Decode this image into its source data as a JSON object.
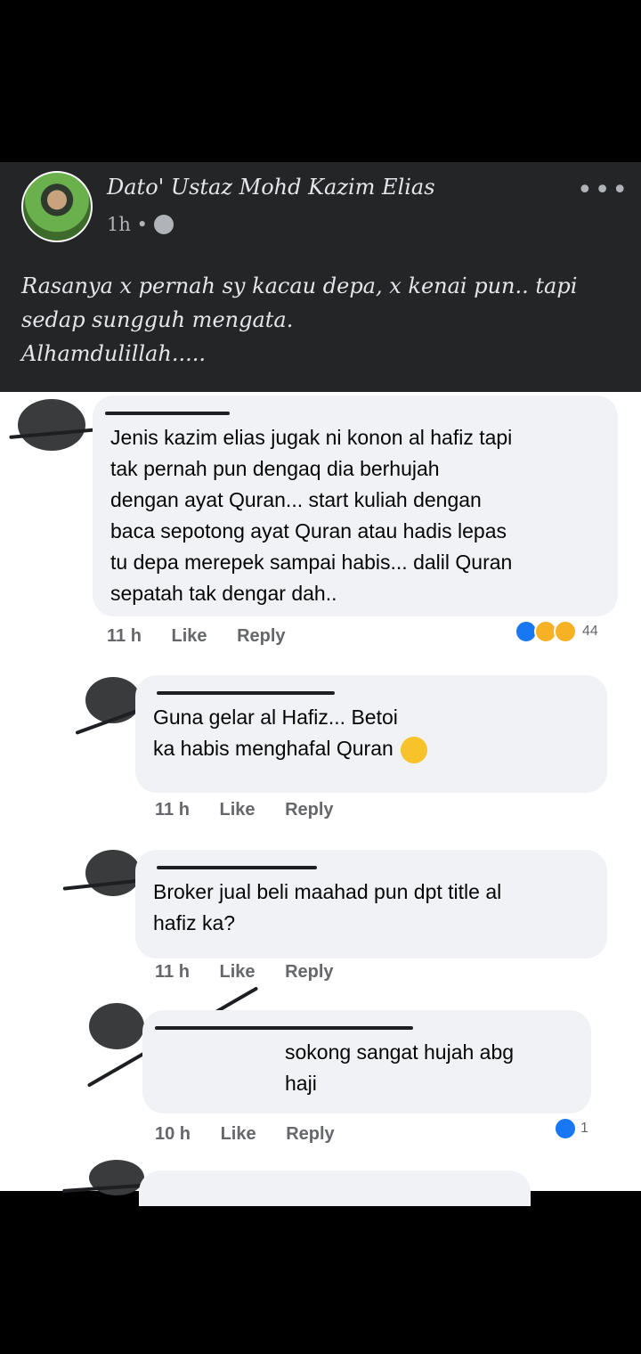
{
  "post": {
    "author": "Dato' Ustaz Mohd Kazim Elias",
    "time": "1h •",
    "text": "Rasanya x pernah sy kacau depa, x kenai pun.. tapi\nsedap sungguh mengata.\nAlhamdulillah....."
  },
  "comments": [
    {
      "text": "Jenis kazim elias jugak ni konon al hafiz tapi\ntak pernah pun dengaq dia berhujah\ndengan ayat Quran... start kuliah dengan\nbaca sepotong ayat Quran atau hadis lepas\ntu depa merepek sampai habis... dalil Quran\nsepatah tak dengar dah..",
      "time": "11 h",
      "like": "Like",
      "reply": "Reply",
      "reactions": "44"
    },
    {
      "text": "Guna gelar al Hafiz... Betoi\nka habis menghafal Quran",
      "time": "11 h",
      "like": "Like",
      "reply": "Reply"
    },
    {
      "text": "Broker jual beli maahad pun dpt title al\nhafiz ka?",
      "time": "11 h",
      "like": "Like",
      "reply": "Reply"
    },
    {
      "text": "sokong sangat hujah abg\nhaji",
      "time": "10 h",
      "like": "Like",
      "reply": "Reply",
      "reactions": "1"
    }
  ],
  "colors": {
    "dark_bg": "#242526",
    "bubble": "#f0f2f5",
    "like_blue": "#1877f2"
  },
  "icons": [
    "globe-icon",
    "more-icon",
    "like-reaction-icon",
    "haha-reaction-icon",
    "thinking-emoji-icon"
  ]
}
